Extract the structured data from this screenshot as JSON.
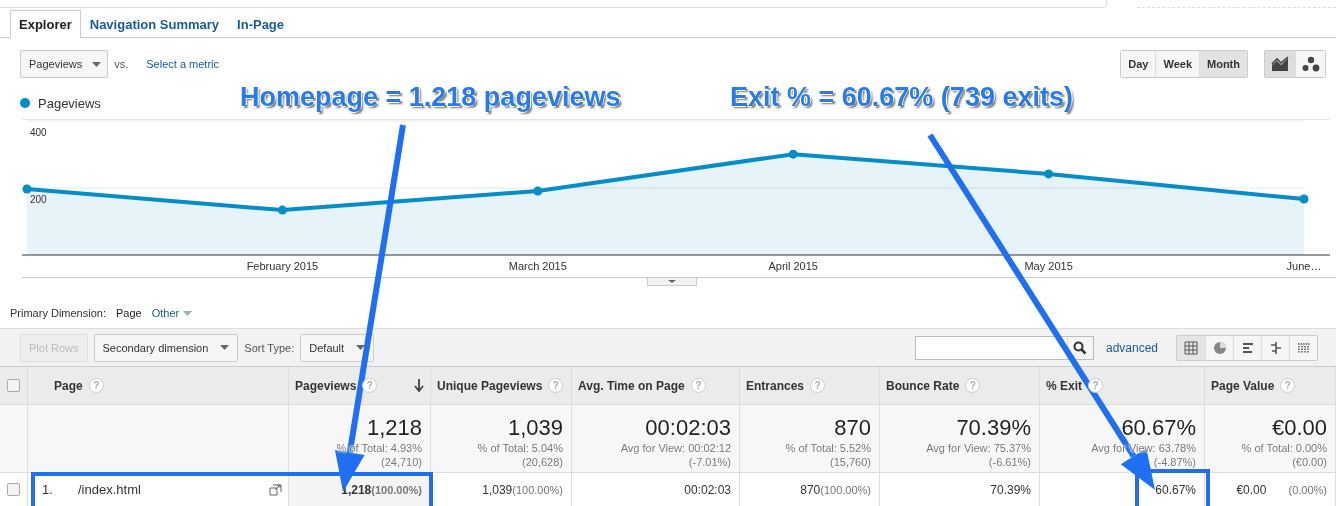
{
  "tabs": [
    {
      "label": "Explorer",
      "selected": true
    },
    {
      "label": "Navigation Summary",
      "selected": false
    },
    {
      "label": "In-Page",
      "selected": false
    }
  ],
  "metric_select": {
    "value": "Pageviews"
  },
  "vs_label": "vs.",
  "select_metric_link": "Select a metric",
  "period_buttons": [
    {
      "label": "Day",
      "selected": false
    },
    {
      "label": "Week",
      "selected": false
    },
    {
      "label": "Month",
      "selected": true
    }
  ],
  "chart_type_buttons": [
    {
      "kind": "line",
      "selected": true
    },
    {
      "kind": "motion",
      "selected": false
    }
  ],
  "chart_data": {
    "type": "area",
    "categories": [
      null,
      "February 2015",
      "March 2015",
      "April 2015",
      "May 2015",
      "June…"
    ],
    "series": [
      {
        "name": "Pageviews",
        "color": "#058dc7",
        "values": [
          197,
          134,
          191,
          301,
          242,
          167
        ]
      }
    ],
    "ylim": [
      0,
      400
    ],
    "yticks": [
      200,
      400
    ]
  },
  "primary_dimension": {
    "label": "Primary Dimension:",
    "options": [
      {
        "label": "Page",
        "selected": true
      },
      {
        "label": "Other",
        "selected": false
      }
    ]
  },
  "toolbar": {
    "plot_rows": {
      "label": "Plot Rows",
      "disabled": true
    },
    "secondary_dimension": "Secondary dimension",
    "sort_type_label": "Sort Type:",
    "sort_select": "Default",
    "advanced_link": "advanced",
    "view_buttons": [
      {
        "kind": "table",
        "selected": true
      },
      {
        "kind": "pie",
        "selected": false
      },
      {
        "kind": "bars",
        "selected": false
      },
      {
        "kind": "comparison",
        "selected": false
      },
      {
        "kind": "pivot",
        "selected": false
      }
    ]
  },
  "table": {
    "select_all": {
      "checked": false
    },
    "columns": [
      {
        "label": "Page",
        "help": "?",
        "sorted": false
      },
      {
        "label": "Pageviews",
        "help": "?",
        "sorted": true
      },
      {
        "label": "Unique Pageviews",
        "help": "?",
        "sorted": false
      },
      {
        "label": "Avg. Time on Page",
        "help": "?",
        "sorted": false
      },
      {
        "label": "Entrances",
        "help": "?",
        "sorted": false
      },
      {
        "label": "Bounce Rate",
        "help": "?",
        "sorted": false
      },
      {
        "label": "% Exit",
        "help": "?",
        "sorted": false
      },
      {
        "label": "Page Value",
        "help": "?",
        "sorted": false
      }
    ],
    "totals": [
      {
        "value": "1,218",
        "detail": "% of Total: 4.93%",
        "base": "(24,710)"
      },
      {
        "value": "1,039",
        "detail": "% of Total: 5.04%",
        "base": "(20,628)"
      },
      {
        "value": "00:02:03",
        "detail": "Avg for View: 00:02:12",
        "base": "(-7.01%)"
      },
      {
        "value": "870",
        "detail": "% of Total: 5.52%",
        "base": "(15,760)"
      },
      {
        "value": "70.39%",
        "detail": "Avg for View: 75.37%",
        "base": "(-6.61%)"
      },
      {
        "value": "60.67%",
        "detail": "Avg for View: 63.78%",
        "base": "(-4.87%)"
      },
      {
        "value": "€0.00",
        "detail": "% of Total: 0.00%",
        "base": "(€0.00)"
      }
    ],
    "rows": [
      {
        "checked": false,
        "cells": [
          {
            "index": "1.",
            "page": "/index.html"
          },
          {
            "value": "1,218",
            "share": "(100.00%)"
          },
          {
            "value": "1,039",
            "share": "(100.00%)"
          },
          {
            "value": "00:02:03"
          },
          {
            "value": "870",
            "share": "(100.00%)"
          },
          {
            "value": "70.39%"
          },
          {
            "value": "60.67%"
          },
          {
            "value": "€0.00",
            "share": "(0.00%)"
          }
        ]
      }
    ]
  },
  "annotations": [
    {
      "kind": "callout",
      "text": "Homepage = 1.218 pageviews"
    },
    {
      "kind": "callout",
      "text": "Exit % = 60.67% (739 exits)"
    }
  ]
}
